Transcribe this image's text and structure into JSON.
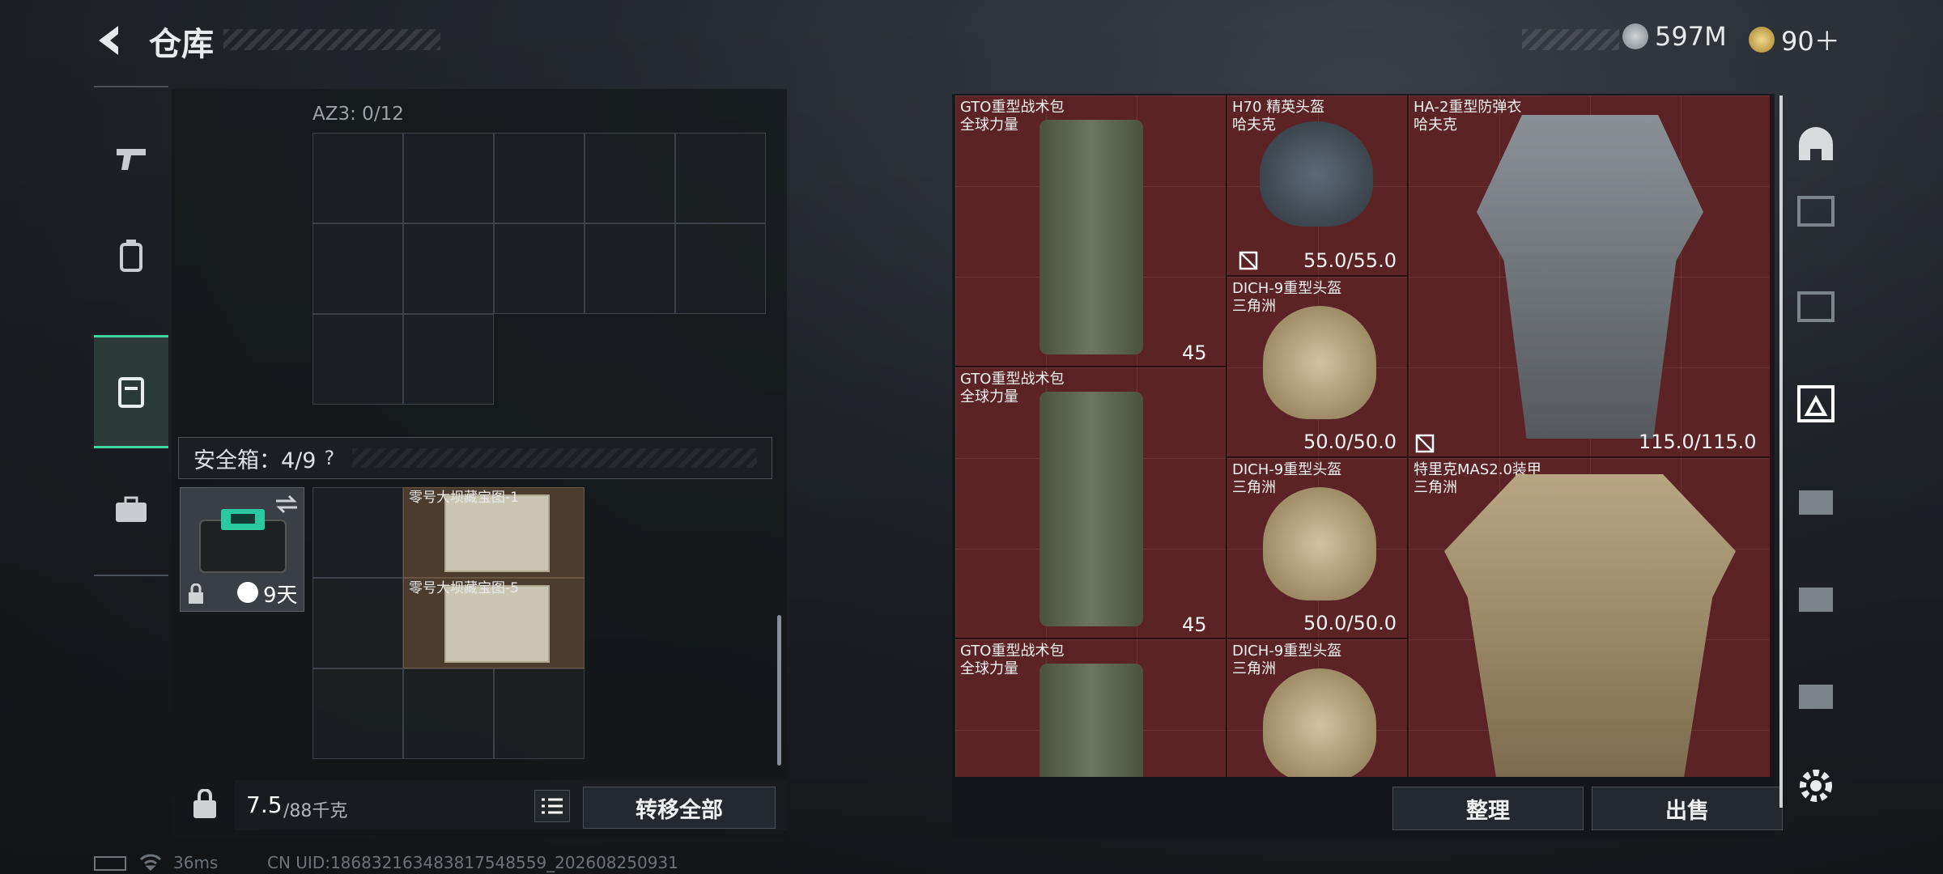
{
  "header": {
    "title": "仓库",
    "silver": "597M",
    "gold": "90＋"
  },
  "storage": {
    "container_label": "AZ3: 0/12",
    "safebox_label": "安全箱：4/9",
    "safebox_help": "?",
    "safebox_days": "9天",
    "map1": "零号大坝藏宝图-1",
    "map2": "零号大坝藏宝图-5",
    "weight_value": "7.5",
    "weight_max": "/88千克",
    "transfer_all": "转移全部"
  },
  "items": [
    {
      "name": "GTO重型战术包",
      "maker": "全球力量",
      "count": "45"
    },
    {
      "name": "H70 精英头盔",
      "maker": "哈夫克",
      "durability": "55.0/55.0"
    },
    {
      "name": "HA-2重型防弹衣",
      "maker": "哈夫克",
      "durability": "115.0/115.0"
    },
    {
      "name": "DICH-9重型头盔",
      "maker": "三角洲",
      "durability": "50.0/50.0"
    },
    {
      "name": "GTO重型战术包",
      "maker": "全球力量",
      "count": "45"
    },
    {
      "name": "DICH-9重型头盔",
      "maker": "三角洲",
      "durability": "50.0/50.0"
    },
    {
      "name": "特里克MAS2.0装甲",
      "maker": "三角洲"
    },
    {
      "name": "GTO重型战术包",
      "maker": "全球力量"
    },
    {
      "name": "DICH-9重型头盔",
      "maker": "三角洲"
    }
  ],
  "actions": {
    "sort": "整理",
    "sell": "出售"
  },
  "status": {
    "ping": "36ms",
    "uid": "CN UID:1868321634838175485​59_202608250931"
  },
  "colors": {
    "accent": "#3fd7a0",
    "grid_red": "#5c2326"
  }
}
